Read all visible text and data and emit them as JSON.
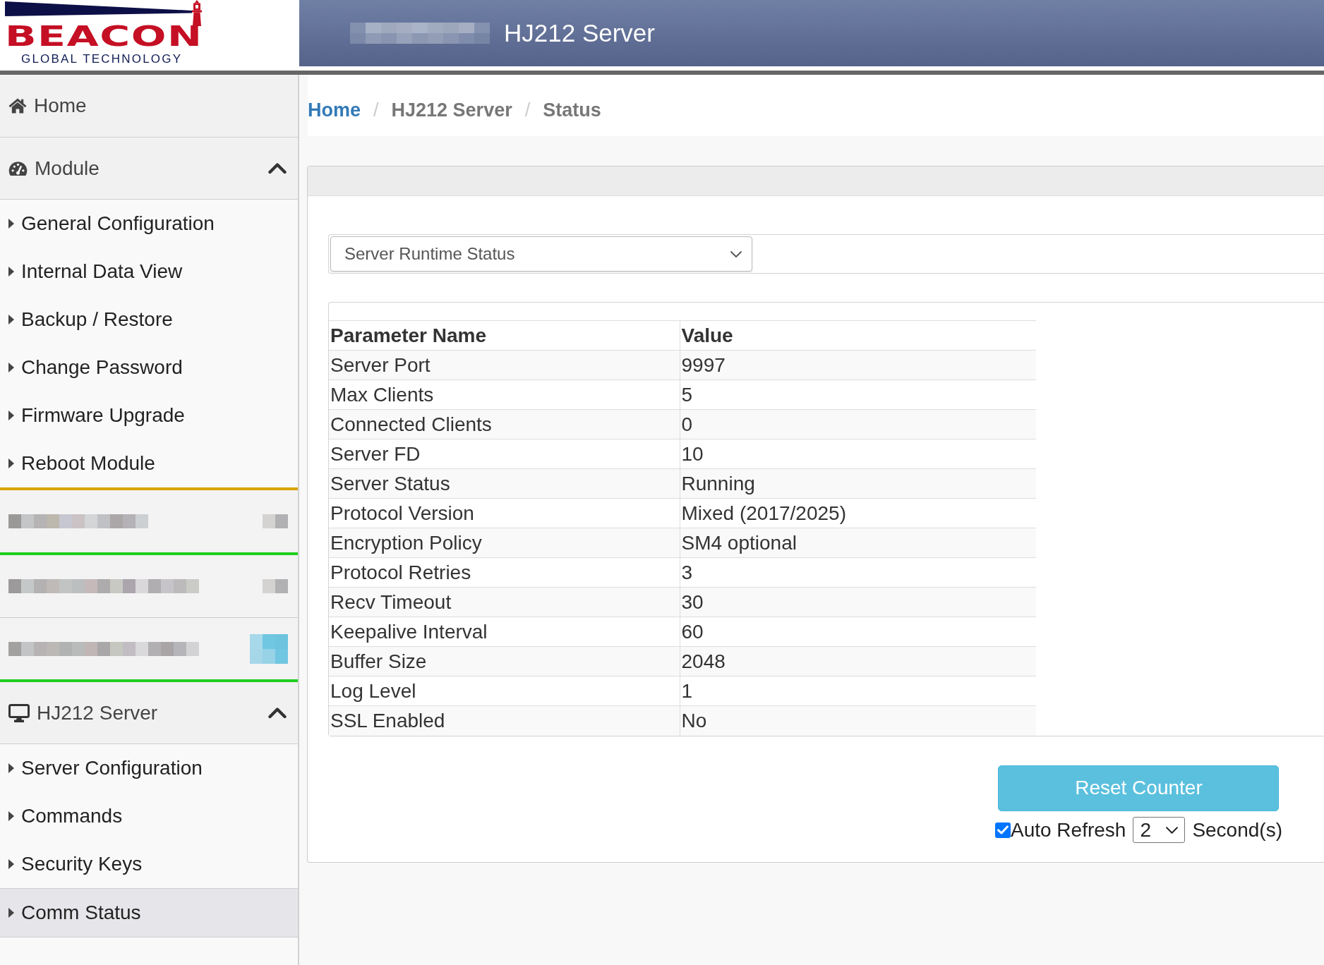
{
  "logo": {
    "wordmark": "BEACON",
    "tagline": "GLOBAL TECHNOLOGY"
  },
  "header": {
    "title": "HJ212 Server"
  },
  "sidebar": {
    "sections": [
      {
        "kind": "link",
        "label": "Home"
      },
      {
        "kind": "group",
        "label": "Module",
        "expanded": true,
        "children": [
          {
            "label": "General Configuration",
            "selected": false
          },
          {
            "label": "Internal Data View",
            "selected": false
          },
          {
            "label": "Backup / Restore",
            "selected": false
          },
          {
            "label": "Change Password",
            "selected": false
          },
          {
            "label": "Firmware Upgrade",
            "selected": false
          },
          {
            "label": "Reboot Module",
            "selected": false
          }
        ]
      },
      {
        "kind": "panel",
        "color": "#d9a300"
      },
      {
        "kind": "panel",
        "color": "#1fcf1f"
      },
      {
        "kind": "button_panel"
      },
      {
        "kind": "group",
        "label": "HJ212 Server",
        "expanded": true,
        "children": [
          {
            "label": "Server Configuration",
            "selected": false
          },
          {
            "label": "Commands",
            "selected": false
          },
          {
            "label": "Security Keys",
            "selected": false
          },
          {
            "label": "Comm Status",
            "selected": true
          }
        ]
      }
    ]
  },
  "breadcrumb": [
    {
      "label": "Home",
      "link": true
    },
    {
      "separator": "/",
      "label": "HJ212 Server",
      "link": false
    },
    {
      "separator": "/",
      "label": "Status",
      "link": false
    }
  ],
  "view_select": {
    "value": "Server Runtime Status"
  },
  "table": {
    "columns": [
      "Parameter Name",
      "Value"
    ],
    "rows": [
      [
        "Server Port",
        "9997"
      ],
      [
        "Max Clients",
        "5"
      ],
      [
        "Connected Clients",
        "0"
      ],
      [
        "Server FD",
        "10"
      ],
      [
        "Server Status",
        "Running"
      ],
      [
        "Protocol Version",
        "Mixed (2017/2025)"
      ],
      [
        "Encryption Policy",
        "SM4 optional"
      ],
      [
        "Protocol Retries",
        "3"
      ],
      [
        "Recv Timeout",
        "30"
      ],
      [
        "Keepalive Interval",
        "60"
      ],
      [
        "Buffer Size",
        "2048"
      ],
      [
        "Log Level",
        "1"
      ],
      [
        "SSL Enabled",
        "No"
      ]
    ]
  },
  "reset_button": {
    "label": "Reset Counter"
  },
  "auto_refresh": {
    "checked": true,
    "label": "Auto Refresh",
    "interval": "2",
    "unit": "Second(s)"
  }
}
